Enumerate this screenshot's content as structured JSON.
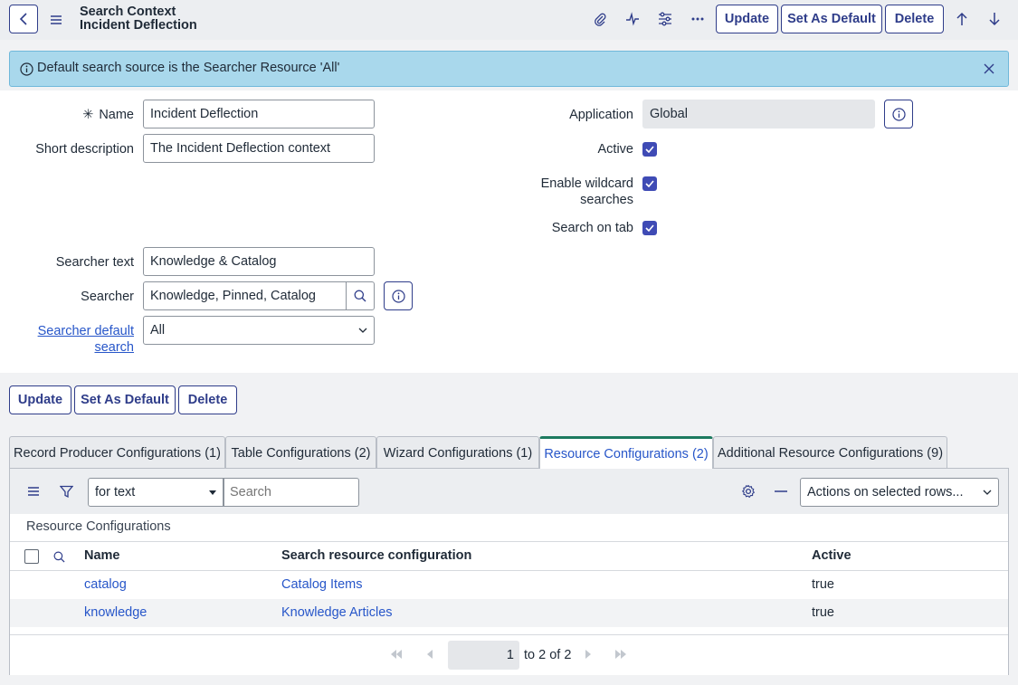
{
  "header": {
    "title_line1": "Search Context",
    "title_line2": "Incident Deflection",
    "buttons": {
      "update": "Update",
      "set_default": "Set As Default",
      "delete": "Delete"
    },
    "icons": [
      "paperclip-icon",
      "activity-icon",
      "sliders-icon",
      "more-icon",
      "arrow-up-icon",
      "arrow-down-icon"
    ]
  },
  "banner": {
    "message": "Default search source is the Searcher Resource 'All'"
  },
  "form": {
    "name_label": "Name",
    "name_value": "Incident Deflection",
    "short_desc_label": "Short description",
    "short_desc_value": "The Incident Deflection context",
    "searcher_text_label": "Searcher text",
    "searcher_text_value": "Knowledge & Catalog",
    "searcher_label": "Searcher",
    "searcher_value": "Knowledge, Pinned, Catalog",
    "searcher_default_label_1": "Searcher default",
    "searcher_default_label_2": "search",
    "searcher_default_value": "All",
    "application_label": "Application",
    "application_value": "Global",
    "active_label": "Active",
    "active_checked": true,
    "wildcard_label_1": "Enable wildcard",
    "wildcard_label_2": "searches",
    "wildcard_checked": true,
    "search_on_tab_label": "Search on tab",
    "search_on_tab_checked": true
  },
  "bottom_buttons": {
    "update": "Update",
    "set_default": "Set As Default",
    "delete": "Delete"
  },
  "tabs": [
    {
      "label": "Record Producer Configurations (1)"
    },
    {
      "label": "Table Configurations (2)"
    },
    {
      "label": "Wizard Configurations (1)"
    },
    {
      "label": "Resource Configurations (2)",
      "active": true
    },
    {
      "label": "Additional Resource Configurations (9)"
    }
  ],
  "list": {
    "filter_select": "for text",
    "search_placeholder": "Search",
    "actions_select": "Actions on selected rows...",
    "caption": "Resource Configurations",
    "columns": {
      "name": "Name",
      "config": "Search resource configuration",
      "active": "Active"
    },
    "rows": [
      {
        "name": "catalog",
        "config": "Catalog Items",
        "active": "true"
      },
      {
        "name": "knowledge",
        "config": "Knowledge Articles",
        "active": "true"
      }
    ],
    "pagination": {
      "page": "1",
      "range_text": "to 2 of 2"
    }
  },
  "colors": {
    "accent": "#2f3d8a",
    "link": "#2756c9",
    "checkbox": "#3f4bb5",
    "banner": "#a9d8ec",
    "active_tab_bar": "#1d7a5f"
  }
}
